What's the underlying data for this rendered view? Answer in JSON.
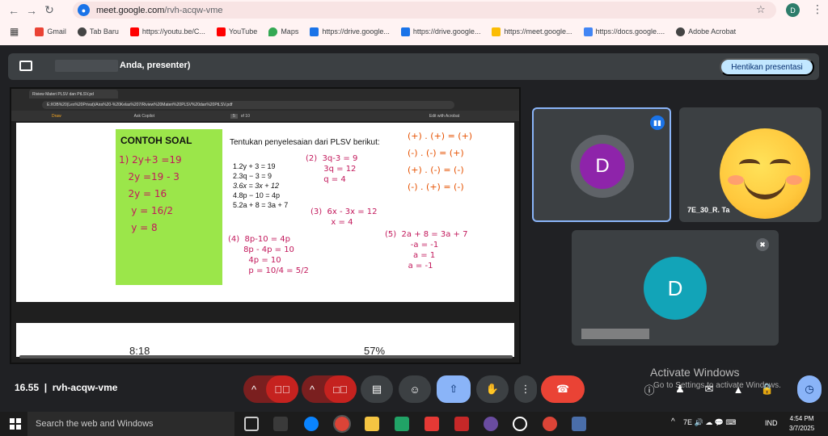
{
  "browser": {
    "url_host": "meet.google.com",
    "url_path": "/rvh-acqw-vme",
    "profile_initial": "D",
    "bookmarks": [
      {
        "label": "Gmail",
        "color": "#ea4335"
      },
      {
        "label": "Tab Baru",
        "color": "#444444"
      },
      {
        "label": "https://youtu.be/C...",
        "color": "#ff0000"
      },
      {
        "label": "YouTube",
        "color": "#ff0000"
      },
      {
        "label": "Maps",
        "color": "#34a853"
      },
      {
        "label": "https://drive.google...",
        "color": "#1a73e8"
      },
      {
        "label": "https://drive.google...",
        "color": "#1a73e8"
      },
      {
        "label": "https://meet.google...",
        "color": "#fbbc04"
      },
      {
        "label": "https://docs.google....",
        "color": "#4285f4"
      },
      {
        "label": "Adobe Acrobat",
        "color": "#444444"
      }
    ]
  },
  "share_bar": {
    "presenter_text": "Anda, presenter)",
    "stop_button": "Hentikan presentasi"
  },
  "shared_screen": {
    "tab_title": "Riview Materi PLSV dan PtLSV.pd",
    "file_path": "E:/IOB%20(Les%20Privat)/Aira%20-%20Kelas%207/Riview%20Materi%20PLSV%20dan%20PtLSV.pdf",
    "toolbar_draw": "Draw",
    "toolbar_copilot": "Ask Copilot",
    "page_current": "5",
    "page_total": "of 10",
    "toolbar_edit": "Edit with Acrobat",
    "contoh_soal": "CONTOH SOAL",
    "green_work": "1) 2y+3 =19\n   2y =19 - 3\n   2y = 16\n    y = 16/2\n    y = 8",
    "task_title": "Tentukan penyelesaian dari PLSV berikut:",
    "tasks": [
      "1.2y + 3 = 19",
      "2.3q − 3 = 9",
      "3.6x = 3x + 12",
      "4.8p − 10 = 4p",
      "5.2a + 8 = 3a + 7"
    ],
    "work2": "(2)  3q-3 = 9\n       3q = 12\n       q = 4",
    "work3": "(3)  6x - 3x = 12\n        x = 4",
    "work4": "(4)  8p-10 = 4p\n      8p - 4p = 10\n        4p = 10\n        p = 10/4 = 5/2",
    "work5": "(5)  2a + 8 = 3a + 7\n          -a = -1\n           a = 1\n         a = -1",
    "sign_rules": "(+) . (+) = (+)\n(-) . (-) = (+)\n(+) . (-) = (-)\n(-) . (+) = (-)",
    "phone_time": "8:18",
    "phone_battery": "57%"
  },
  "participants": [
    {
      "initial": "D",
      "color": "#8e24aa",
      "name": ""
    },
    {
      "initial": "",
      "color": "#ffc83d",
      "name": "7E_30_R. Ta"
    },
    {
      "initial": "D",
      "color": "#12a4b8",
      "name": ""
    }
  ],
  "bottom_bar": {
    "time": "16.55",
    "meeting_code": "rvh-acqw-vme"
  },
  "activation": {
    "title": "Activate Windows",
    "subtitle": "Go to Settings to activate Windows."
  },
  "taskbar": {
    "search_placeholder": "Search the web and Windows",
    "language": "IND",
    "clock_time": "4:54 PM",
    "clock_date": "3/7/2025"
  }
}
